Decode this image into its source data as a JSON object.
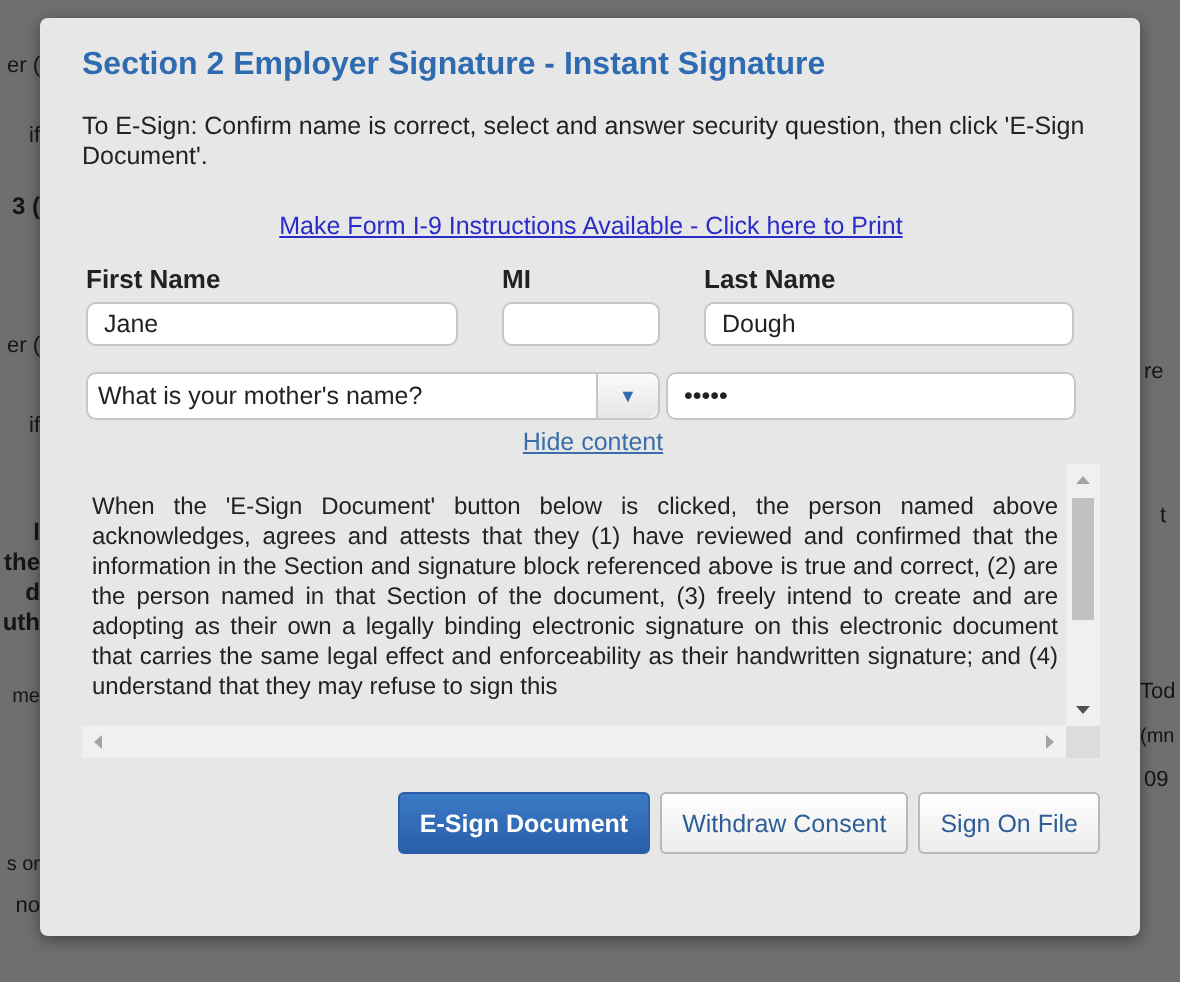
{
  "background_page": {
    "left_fragments": [
      {
        "text": "er (",
        "kind": "label"
      },
      {
        "text": "if",
        "kind": "label"
      },
      {
        "text": "3 (",
        "kind": "heading"
      },
      {
        "text": "er (",
        "kind": "label"
      },
      {
        "text": "if",
        "kind": "label"
      },
      {
        "text": "l",
        "kind": "heading"
      },
      {
        "text": "the",
        "kind": "heading"
      },
      {
        "text": "d",
        "kind": "heading"
      },
      {
        "text": "uth",
        "kind": "heading"
      },
      {
        "text": "me",
        "kind": "small"
      },
      {
        "text": "s or",
        "kind": "small"
      },
      {
        "text": "no",
        "kind": "label"
      }
    ],
    "right_fragments": [
      {
        "text": "re",
        "kind": "label"
      },
      {
        "text": "t",
        "kind": "label"
      },
      {
        "text": "Tod",
        "kind": "label"
      },
      {
        "text": "(mn",
        "kind": "small"
      },
      {
        "text": "09",
        "kind": "label"
      }
    ]
  },
  "dialog": {
    "title": "Section 2 Employer Signature - Instant Signature",
    "instructions": "To E-Sign: Confirm name is correct, select and answer security question, then click 'E-Sign Document'.",
    "print_link": "Make Form I-9 Instructions Available - Click here to Print",
    "fields": [
      {
        "label": "First Name",
        "value": "Jane"
      },
      {
        "label": "MI"
      },
      {
        "label": "Last Name",
        "value": "Dough"
      }
    ],
    "security_question": {
      "value": "What is your mother's name?",
      "arrow": "▼"
    },
    "security_answer": {
      "value": "•••••"
    },
    "hide_link": "Hide content",
    "consent_text": "When the 'E-Sign Document' button below is clicked, the person named above acknowledges, agrees and attests that they (1) have reviewed and confirmed that the information in the Section and signature block referenced above is true and correct, (2) are the person named in that Section of the document, (3) freely intend to create and are adopting as their own a legally binding electronic signature on this electronic document that carries the same legal effect and enforceability as their handwritten signature; and (4) understand that they may refuse to sign this",
    "buttons": [
      {
        "label": "E-Sign Document",
        "kind": "primary"
      },
      {
        "label": "Withdraw Consent",
        "kind": "secondary"
      },
      {
        "label": "Sign On File",
        "kind": "secondary"
      }
    ]
  }
}
